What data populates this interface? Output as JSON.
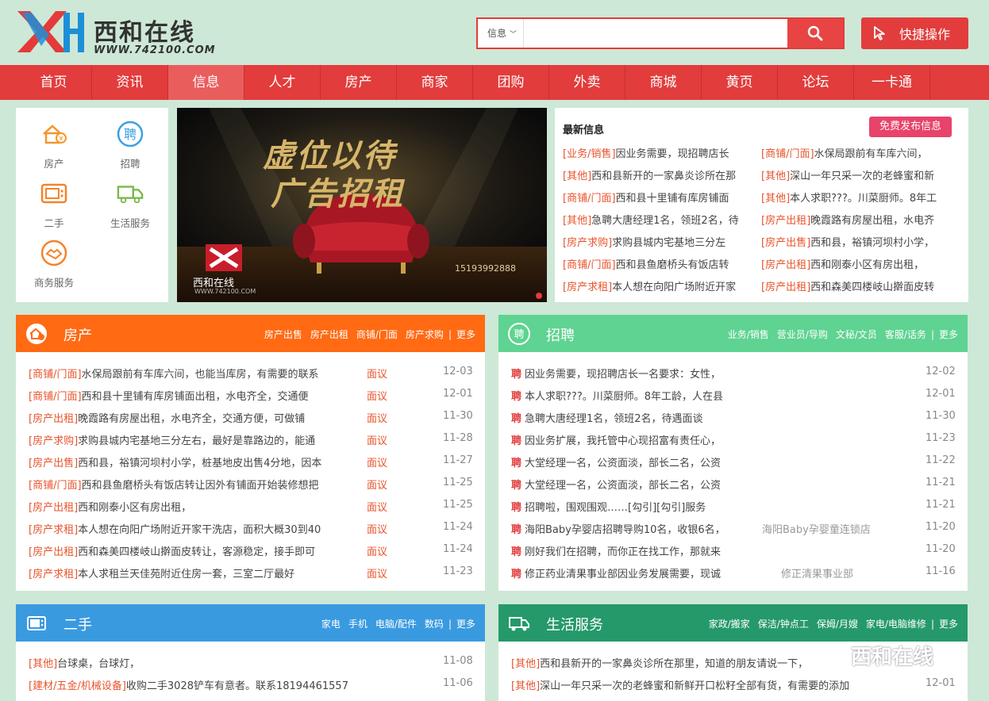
{
  "logo": {
    "name": "西和在线",
    "url": "WWW.742100.COM"
  },
  "search": {
    "category": "信息",
    "placeholder": ""
  },
  "quick": {
    "label": "快捷操作"
  },
  "nav": [
    "首页",
    "资讯",
    "信息",
    "人才",
    "房产",
    "商家",
    "团购",
    "外卖",
    "商城",
    "黄页",
    "论坛",
    "一卡通"
  ],
  "nav_active": "信息",
  "categories": [
    {
      "label": "房产",
      "icon": "house-icon"
    },
    {
      "label": "招聘",
      "icon": "recruit-icon"
    },
    {
      "label": "二手",
      "icon": "tv-icon"
    },
    {
      "label": "生活服务",
      "icon": "truck-icon"
    },
    {
      "label": "商务服务",
      "icon": "handshake-icon"
    }
  ],
  "banner": {
    "headline1": "虚位以待",
    "headline2": "广告招租",
    "phone": "15193992888",
    "brand": "西和在线",
    "brand_url": "WWW.742100.COM"
  },
  "latest": {
    "title": "最新信息",
    "publish_label": "免费发布信息",
    "left": [
      {
        "tag": "[业务/销售]",
        "text": "因业务需要，现招聘店长"
      },
      {
        "tag": "[其他]",
        "text": "西和县新开的一家鼻炎诊所在那"
      },
      {
        "tag": "[商铺/门面]",
        "text": "西和县十里铺有库房铺面"
      },
      {
        "tag": "[其他]",
        "text": "急聘大唐经理1名，领班2名，待"
      },
      {
        "tag": "[房产求购]",
        "text": "求购县城内宅基地三分左"
      },
      {
        "tag": "[商铺/门面]",
        "text": "西和县鱼磨桥头有饭店转"
      },
      {
        "tag": "[房产求租]",
        "text": "本人想在向阳广场附近开家"
      }
    ],
    "right": [
      {
        "tag": "[商铺/门面]",
        "text": "水保局跟前有车库六间，"
      },
      {
        "tag": "[其他]",
        "text": "深山一年只采一次的老蜂蜜和新"
      },
      {
        "tag": "[其他]",
        "text": "本人求职???。川菜厨师。8年工"
      },
      {
        "tag": "[房产出租]",
        "text": "晚霞路有房屋出租，水电齐"
      },
      {
        "tag": "[房产出售]",
        "text": "西和县，裕镇河坝村小学，"
      },
      {
        "tag": "[房产出租]",
        "text": "西和刚泰小区有房出租，"
      },
      {
        "tag": "[房产出租]",
        "text": "西和森美四楼岐山擀面皮转"
      }
    ]
  },
  "realestate": {
    "title": "房产",
    "links": [
      "房产出售",
      "房产出租",
      "商铺/门面",
      "房产求购",
      "更多"
    ],
    "rows": [
      {
        "tag": "[商铺/门面]",
        "text": "水保局跟前有车库六间，也能当库房，有需要的联系",
        "price": "面议",
        "date": "12-03"
      },
      {
        "tag": "[商铺/门面]",
        "text": "西和县十里铺有库房铺面出租，水电齐全，交通便",
        "price": "面议",
        "date": "12-01"
      },
      {
        "tag": "[房产出租]",
        "text": "晚霞路有房屋出租，水电齐全，交通方便，可做铺",
        "price": "面议",
        "date": "11-30"
      },
      {
        "tag": "[房产求购]",
        "text": "求购县城内宅基地三分左右，最好是靠路边的，能通",
        "price": "面议",
        "date": "11-28"
      },
      {
        "tag": "[房产出售]",
        "text": "西和县，裕镇河坝村小学，桩基地皮出售4分地，因本",
        "price": "面议",
        "date": "11-27"
      },
      {
        "tag": "[商铺/门面]",
        "text": "西和县鱼磨桥头有饭店转让因外有铺面开始装修想把",
        "price": "面议",
        "date": "11-25"
      },
      {
        "tag": "[房产出租]",
        "text": "西和刚泰小区有房出租，",
        "price": "面议",
        "date": "11-25"
      },
      {
        "tag": "[房产求租]",
        "text": "本人想在向阳广场附近开家干洗店，面积大概30到40",
        "price": "面议",
        "date": "11-24"
      },
      {
        "tag": "[房产出租]",
        "text": "西和森美四楼岐山擀面皮转让，客源稳定，接手即可",
        "price": "面议",
        "date": "11-24"
      },
      {
        "tag": "[房产求租]",
        "text": "本人求租兰天佳苑附近住房一套，三室二厅最好",
        "price": "面议",
        "date": "11-23"
      }
    ]
  },
  "jobs": {
    "title": "招聘",
    "links": [
      "业务/销售",
      "营业员/导购",
      "文秘/文员",
      "客服/话务",
      "更多"
    ],
    "pin": "聘",
    "rows": [
      {
        "text": "因业务需要，现招聘店长一名要求：女性，",
        "company": "",
        "date": "12-02"
      },
      {
        "text": "本人求职???。川菜厨师。8年工龄，人在县",
        "company": "",
        "date": "12-01"
      },
      {
        "text": "急聘大唐经理1名，领班2名，待遇面谈",
        "company": "",
        "date": "11-30"
      },
      {
        "text": "因业务扩展，我托管中心现招富有责任心，",
        "company": "",
        "date": "11-23"
      },
      {
        "text": "大堂经理一名，公资面淡，部长二名，公资",
        "company": "",
        "date": "11-22"
      },
      {
        "text": "大堂经理一名，公资面淡，部长二名，公资",
        "company": "",
        "date": "11-21"
      },
      {
        "text": "招聘啦，围观围观……[勾引][勾引]服务",
        "company": "",
        "date": "11-21"
      },
      {
        "text": "海阳Baby孕婴店招聘导购10名，收银6名，",
        "company": "海阳Baby孕婴童连锁店",
        "date": "11-20"
      },
      {
        "text": "刚好我们在招聘，而你正在找工作，那就来",
        "company": "",
        "date": "11-20"
      },
      {
        "text": "修正药业清果事业部因业务发展需要，现诚",
        "company": "修正清果事业部",
        "date": "11-16"
      }
    ]
  },
  "secondhand": {
    "title": "二手",
    "links": [
      "家电",
      "手机",
      "电脑/配件",
      "数码",
      "更多"
    ],
    "rows": [
      {
        "tag": "[其他]",
        "text": "台球桌，台球灯，",
        "date": "11-08"
      },
      {
        "tag": "[建材/五金/机械设备]",
        "text": "收购二手3028铲车有意者。联系18194461557",
        "date": "11-06"
      }
    ]
  },
  "life": {
    "title": "生活服务",
    "links": [
      "家政/搬家",
      "保洁/钟点工",
      "保姆/月嫂",
      "家电/电脑维修",
      "更多"
    ],
    "rows": [
      {
        "tag": "[其他]",
        "text": "西和县新开的一家鼻炎诊所在那里，知道的朋友请说一下，",
        "date": ""
      },
      {
        "tag": "[其他]",
        "text": "深山一年只采一次的老蜂蜜和新鲜开口松籽全部有货，有需要的添加",
        "date": "12-01"
      }
    ]
  },
  "watermark": "西和在线",
  "colors": {
    "nav": "#e23c3c",
    "realestate": "#ff6a13",
    "jobs": "#5fd391",
    "secondhand": "#3a9ae0",
    "life": "#25996a",
    "tag": "#e8542c"
  }
}
